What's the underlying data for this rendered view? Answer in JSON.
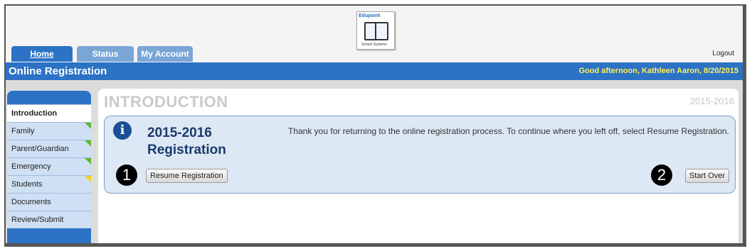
{
  "logo": {
    "brand": "Edupoint",
    "sub": "School Systems"
  },
  "tabs": [
    {
      "label": "Home"
    },
    {
      "label": "Status"
    },
    {
      "label": "My Account"
    }
  ],
  "logout_label": "Logout",
  "header": {
    "title": "Online Registration",
    "greeting": "Good afternoon, Kathleen Aaron, 8/20/2015"
  },
  "sidebar": {
    "items": [
      {
        "label": "Introduction",
        "active": true,
        "flag": null
      },
      {
        "label": "Family",
        "flag": "green"
      },
      {
        "label": "Parent/Guardian",
        "flag": "green"
      },
      {
        "label": "Emergency",
        "flag": "green"
      },
      {
        "label": "Students",
        "flag": "yellow"
      },
      {
        "label": "Documents",
        "flag": null
      },
      {
        "label": "Review/Submit",
        "flag": null
      }
    ]
  },
  "main": {
    "title": "INTRODUCTION",
    "year": "2015-2016",
    "panel": {
      "heading": "2015-2016 Registration",
      "message": "Thank you for returning to the online registration process. To continue where you left off, select Resume Registration.",
      "resume_label": "Resume Registration",
      "start_over_label": "Start Over",
      "badge_1": "1",
      "badge_2": "2"
    }
  },
  "colors": {
    "accent": "#2c73c6",
    "greeting": "#ffef5a",
    "flag_green": "#5fb832",
    "flag_yellow": "#f2d11a"
  }
}
